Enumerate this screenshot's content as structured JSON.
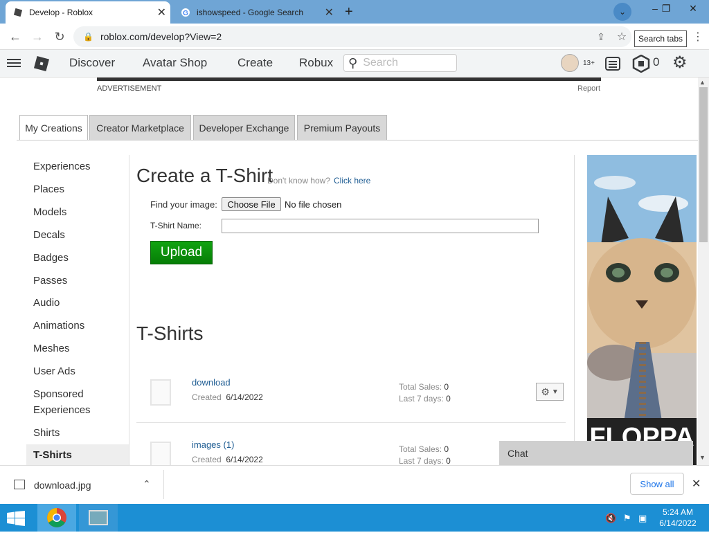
{
  "browser": {
    "tabs": [
      {
        "title": "Develop - Roblox",
        "active": true
      },
      {
        "title": "ishowspeed - Google Search",
        "active": false
      }
    ],
    "url": "roblox.com/develop?View=2",
    "search_tabs_tooltip": "Search tabs"
  },
  "header": {
    "nav": [
      "Discover",
      "Avatar Shop",
      "Create",
      "Robux"
    ],
    "search_placeholder": "Search",
    "age_badge": "13+",
    "robux_count": "0"
  },
  "ad": {
    "label": "ADVERTISEMENT",
    "report": "Report"
  },
  "dev_tabs": [
    "My Creations",
    "Creator Marketplace",
    "Developer Exchange",
    "Premium Payouts"
  ],
  "left_nav": [
    "Experiences",
    "Places",
    "Models",
    "Decals",
    "Badges",
    "Passes",
    "Audio",
    "Animations",
    "Meshes",
    "User Ads",
    "Sponsored",
    "Experiences",
    "Shirts",
    "T-Shirts"
  ],
  "create": {
    "title": "Create a T-Shirt",
    "help_text": "Don't know how?",
    "help_link": "Click here",
    "find_image_label": "Find your image:",
    "choose_file": "Choose File",
    "no_file": "No file chosen",
    "name_label": "T-Shirt Name:",
    "upload": "Upload"
  },
  "list": {
    "title": "T-Shirts",
    "items": [
      {
        "name": "download",
        "created_label": "Created",
        "created": "6/14/2022",
        "total_sales_label": "Total Sales:",
        "total_sales": "0",
        "last7_label": "Last 7 days:",
        "last7": "0"
      },
      {
        "name": "images (1)",
        "created_label": "Created",
        "created": "6/14/2022",
        "total_sales_label": "Total Sales:",
        "total_sales": "0",
        "last7_label": "Last 7 days:",
        "last7": "0"
      }
    ]
  },
  "side_ad_text": "FLOPPA",
  "chat": "Chat",
  "download_bar": {
    "file": "download.jpg",
    "show_all": "Show all"
  },
  "taskbar": {
    "time": "5:24 AM",
    "date": "6/14/2022"
  }
}
